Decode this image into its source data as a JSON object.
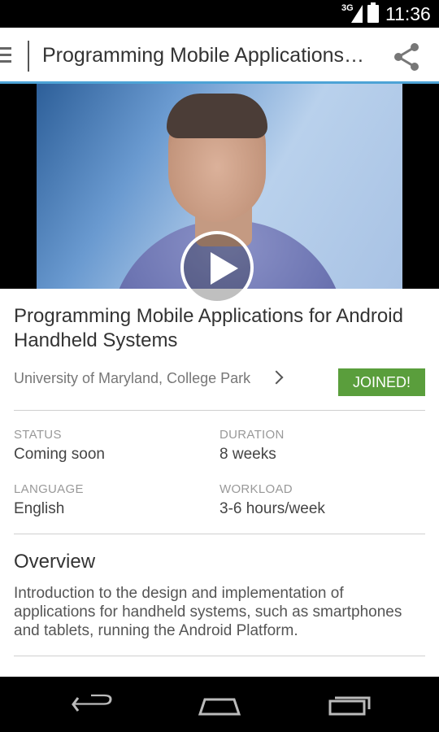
{
  "status_bar": {
    "network": "3G",
    "time": "11:36"
  },
  "action_bar": {
    "title": "Programming Mobile Applications…"
  },
  "video": {
    "play_label": "Play"
  },
  "course": {
    "title": "Programming Mobile Applications for Android Handheld Systems",
    "university": "University of Maryland, College Park",
    "joined_label": "JOINED!",
    "joined_color": "#5a9e3c"
  },
  "details": {
    "status_label": "STATUS",
    "status_value": "Coming soon",
    "duration_label": "DURATION",
    "duration_value": "8 weeks",
    "language_label": "LANGUAGE",
    "language_value": "English",
    "workload_label": "WORKLOAD",
    "workload_value": "3-6 hours/week"
  },
  "overview": {
    "heading": "Overview",
    "text": "Introduction to the design and implementation of applications for handheld systems, such as smartphones and tablets, running the Android Platform."
  },
  "nav_bar": {
    "icons": [
      "back-icon",
      "home-icon",
      "recent-apps-icon"
    ]
  },
  "colors": {
    "accent": "#4da3d6",
    "joined": "#5a9e3c"
  }
}
